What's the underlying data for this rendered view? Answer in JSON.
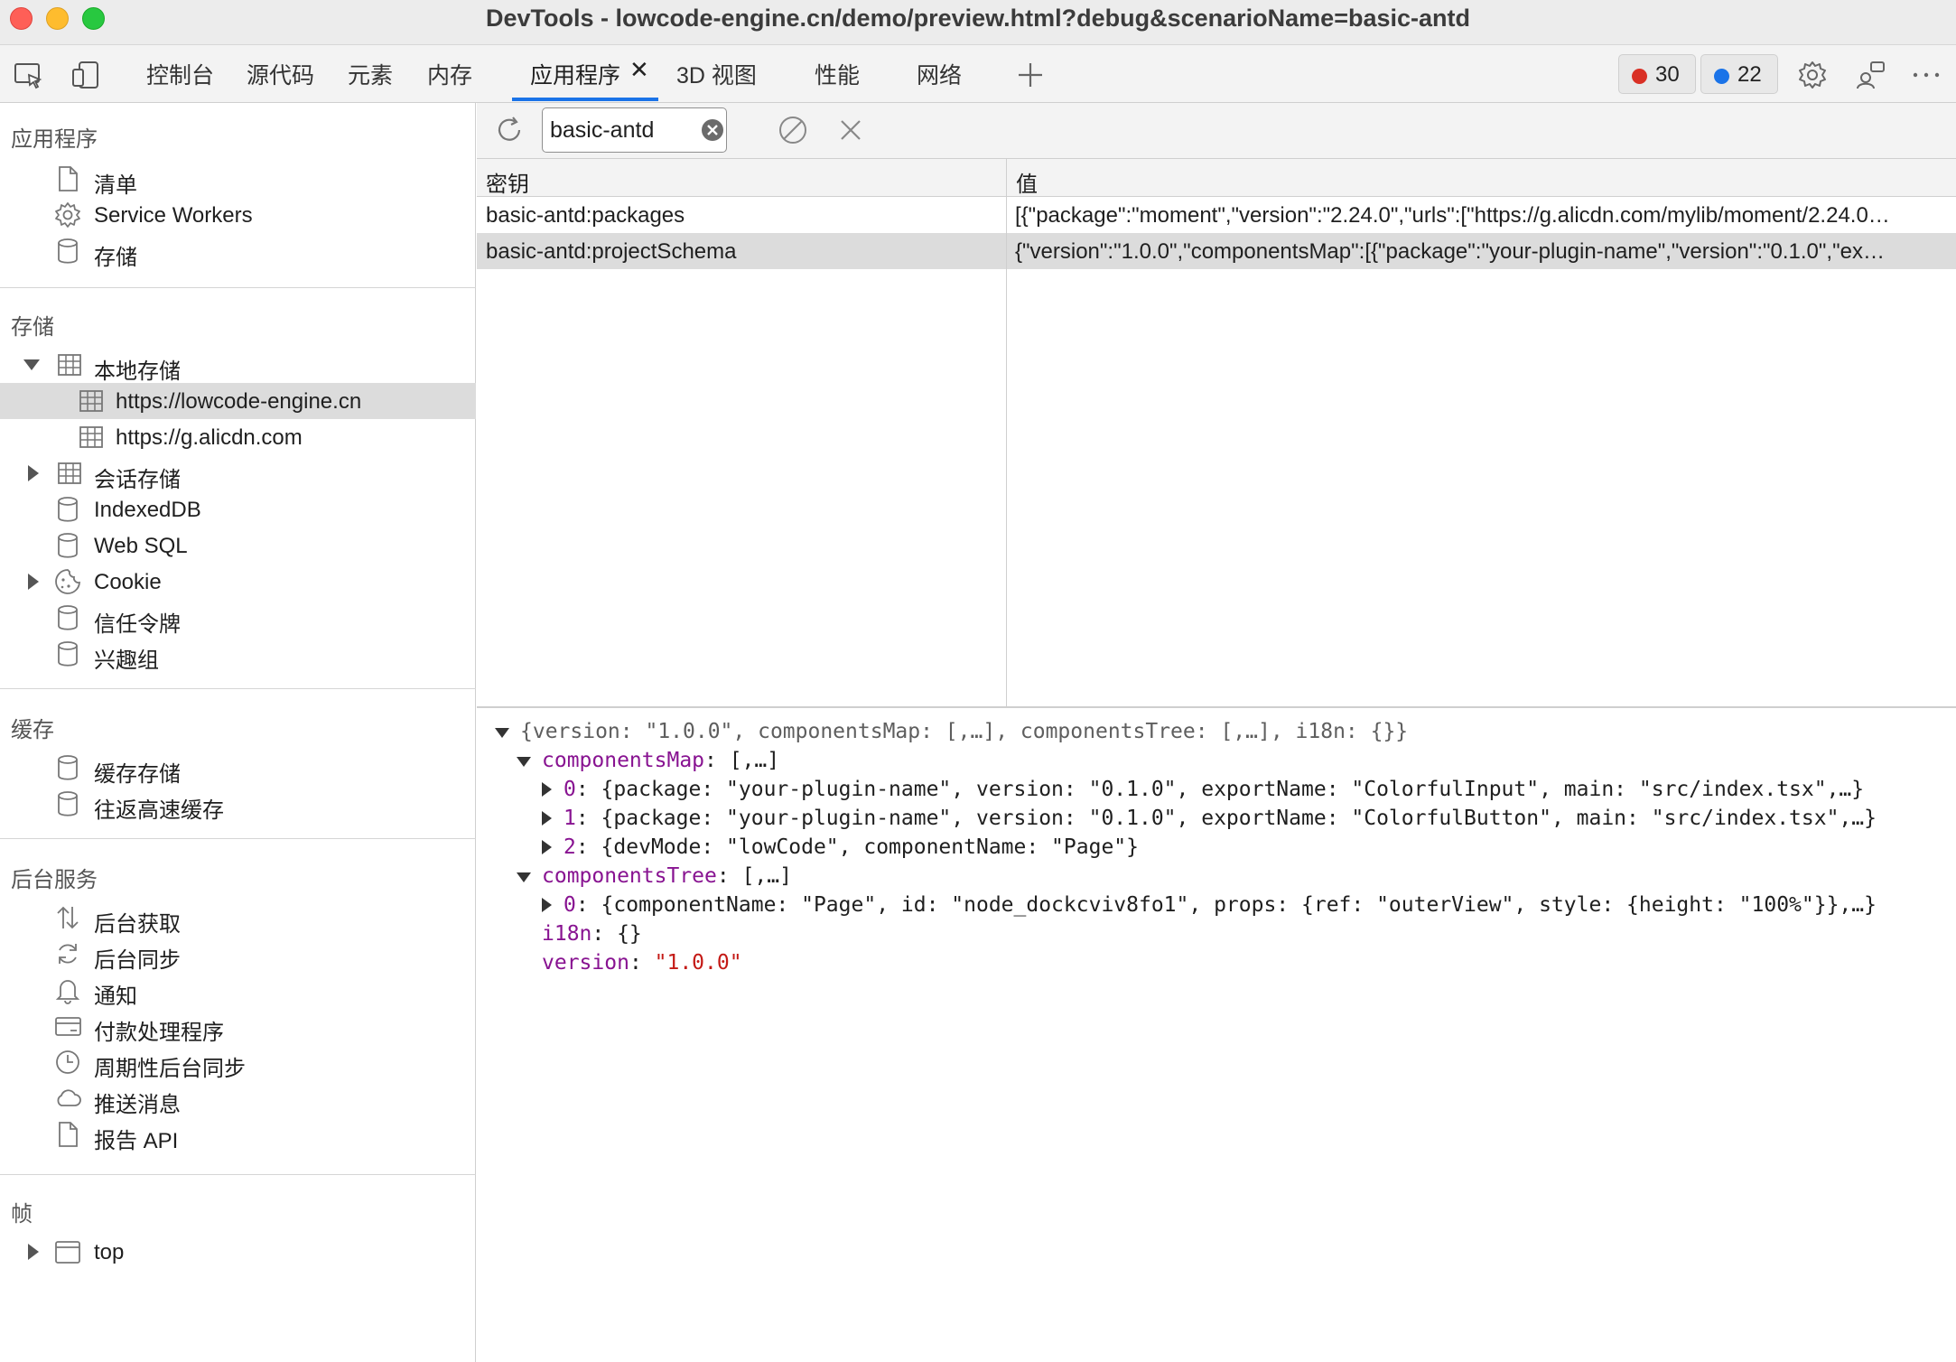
{
  "window": {
    "title": "DevTools - lowcode-engine.cn/demo/preview.html?debug&scenarioName=basic-antd"
  },
  "tabs": [
    {
      "label": "控制台"
    },
    {
      "label": "源代码"
    },
    {
      "label": "元素"
    },
    {
      "label": "内存"
    },
    {
      "label": "应用程序",
      "active": true
    },
    {
      "label": "3D 视图"
    },
    {
      "label": "性能"
    },
    {
      "label": "网络"
    }
  ],
  "badges": {
    "errors": "30",
    "messages": "22",
    "error_color": "#d93025",
    "message_color": "#1a73e8"
  },
  "sidebar": {
    "sections": {
      "app": "应用程序",
      "storage": "存储",
      "cache": "缓存",
      "background": "后台服务",
      "frames": "帧"
    },
    "app_items": [
      "清单",
      "Service Workers",
      "存储"
    ],
    "storage_items": {
      "local_storage": "本地存储",
      "local_children": [
        "https://lowcode-engine.cn",
        "https://g.alicdn.com"
      ],
      "session_storage": "会话存储",
      "indexeddb": "IndexedDB",
      "websql": "Web SQL",
      "cookie": "Cookie",
      "trust_tokens": "信任令牌",
      "interest_groups": "兴趣组"
    },
    "cache_items": [
      "缓存存储",
      "往返高速缓存"
    ],
    "background_items": [
      "后台获取",
      "后台同步",
      "通知",
      "付款处理程序",
      "周期性后台同步",
      "推送消息",
      "报告 API"
    ],
    "frames_items": [
      "top"
    ]
  },
  "filter": {
    "value": "basic-antd"
  },
  "table": {
    "headers": {
      "key": "密钥",
      "value": "值"
    },
    "rows": [
      {
        "key": "basic-antd:packages",
        "value": "[{\"package\":\"moment\",\"version\":\"2.24.0\",\"urls\":[\"https://g.alicdn.com/mylib/moment/2.24.0…"
      },
      {
        "key": "basic-antd:projectSchema",
        "value": "{\"version\":\"1.0.0\",\"componentsMap\":[{\"package\":\"your-plugin-name\",\"version\":\"0.1.0\",\"ex…",
        "selected": true
      }
    ]
  },
  "preview": {
    "root": "{version: \"1.0.0\", componentsMap: [,…], componentsTree: [,…], i18n: {}}",
    "componentsMap_key": "componentsMap",
    "componentsMap_val": ": [,…]",
    "map_items": [
      {
        "idx": "0",
        "text": ": {package: \"your-plugin-name\", version: \"0.1.0\", exportName: \"ColorfulInput\", main: \"src/index.tsx\",…}"
      },
      {
        "idx": "1",
        "text": ": {package: \"your-plugin-name\", version: \"0.1.0\", exportName: \"ColorfulButton\", main: \"src/index.tsx\",…}"
      },
      {
        "idx": "2",
        "text": ": {devMode: \"lowCode\", componentName: \"Page\"}"
      }
    ],
    "componentsTree_key": "componentsTree",
    "componentsTree_val": ": [,…]",
    "tree_items": [
      {
        "idx": "0",
        "text": ": {componentName: \"Page\", id: \"node_dockcviv8fo1\", props: {ref: \"outerView\", style: {height: \"100%\"}},…}"
      }
    ],
    "i18n_key": "i18n",
    "i18n_val": ": {}",
    "version_key": "version",
    "version_sep": ": ",
    "version_val": "\"1.0.0\""
  }
}
